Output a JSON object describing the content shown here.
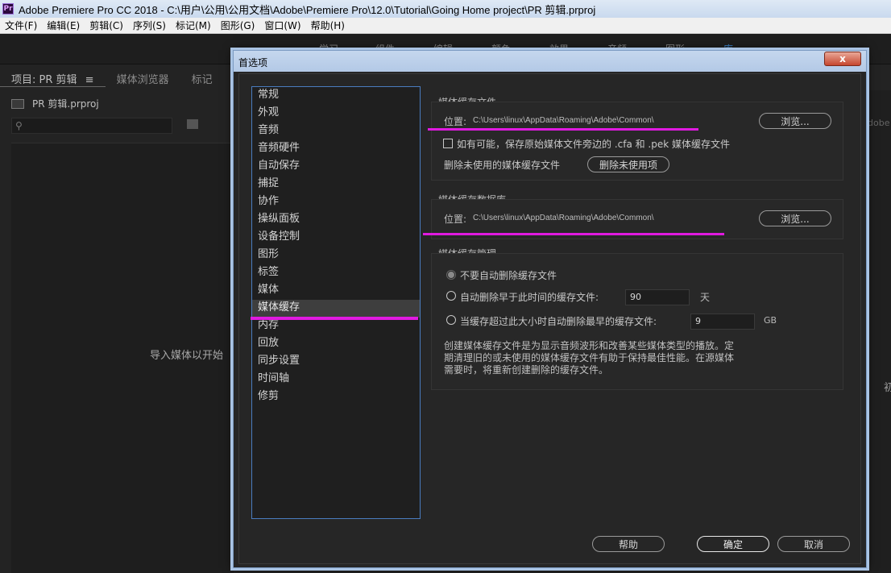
{
  "window": {
    "title": "Adobe Premiere Pro CC 2018 - C:\\用户\\公用\\公用文档\\Adobe\\Premiere Pro\\12.0\\Tutorial\\Going Home project\\PR 剪辑.prproj",
    "app_icon": "Pr"
  },
  "menubar": [
    "文件(F)",
    "编辑(E)",
    "剪辑(C)",
    "序列(S)",
    "标记(M)",
    "图形(G)",
    "窗口(W)",
    "帮助(H)"
  ],
  "workspace_tabs": [
    {
      "label": "学习"
    },
    {
      "label": "组件"
    },
    {
      "label": "编辑"
    },
    {
      "label": "颜色"
    },
    {
      "label": "效果"
    },
    {
      "label": "音频"
    },
    {
      "label": "图形"
    },
    {
      "label": "库"
    }
  ],
  "project_panel": {
    "tabs": [
      "项目: PR 剪辑",
      "媒体浏览器",
      "标记"
    ],
    "menu_icon": "≡",
    "file_name": "PR 剪辑.prproj",
    "import_hint": "导入媒体以开始"
  },
  "right_panel": {
    "peek_text": "dobe S",
    "peek_char": "初"
  },
  "dialog": {
    "title": "首选项",
    "close_label": "x",
    "categories": [
      "常规",
      "外观",
      "音频",
      "音频硬件",
      "自动保存",
      "捕捉",
      "协作",
      "操纵面板",
      "设备控制",
      "图形",
      "标签",
      "媒体",
      "媒体缓存",
      "内存",
      "回放",
      "同步设置",
      "时间轴",
      "修剪"
    ],
    "selected_category": "媒体缓存",
    "media_cache_files": {
      "label": "媒体缓存文件",
      "location_label": "位置:",
      "location_path": "C:\\Users\\linux\\AppData\\Roaming\\Adobe\\Common\\",
      "browse_label": "浏览...",
      "checkbox_label": "如有可能，保存原始媒体文件旁边的 .cfa 和 .pek 媒体缓存文件",
      "checkbox_checked": false,
      "delete_unused_label": "删除未使用的媒体缓存文件",
      "delete_unused_button": "删除未使用项"
    },
    "media_cache_db": {
      "label": "媒体缓存数据库",
      "location_label": "位置:",
      "location_path": "C:\\Users\\linux\\AppData\\Roaming\\Adobe\\Common\\",
      "browse_label": "浏览..."
    },
    "media_cache_mgmt": {
      "label": "媒体缓存管理",
      "option_no_auto": "不要自动删除缓存文件",
      "option_older": "自动删除早于此时间的缓存文件:",
      "older_value": "90",
      "older_unit": "天",
      "option_size": "当缓存超过此大小时自动删除最早的缓存文件:",
      "size_value": "9",
      "size_unit": "GB",
      "selected_option": "no_auto",
      "description": "创建媒体缓存文件是为显示音频波形和改善某些媒体类型的播放。定\n期清理旧的或未使用的媒体缓存文件有助于保持最佳性能。在源媒体\n需要时，将重新创建删除的缓存文件。"
    },
    "footer": {
      "help": "帮助",
      "ok": "确定",
      "cancel": "取消"
    }
  },
  "colors": {
    "highlight_annotation": "#e01ae0",
    "dialog_border": "#7c9bc2",
    "list_border": "#4a7cbf"
  }
}
